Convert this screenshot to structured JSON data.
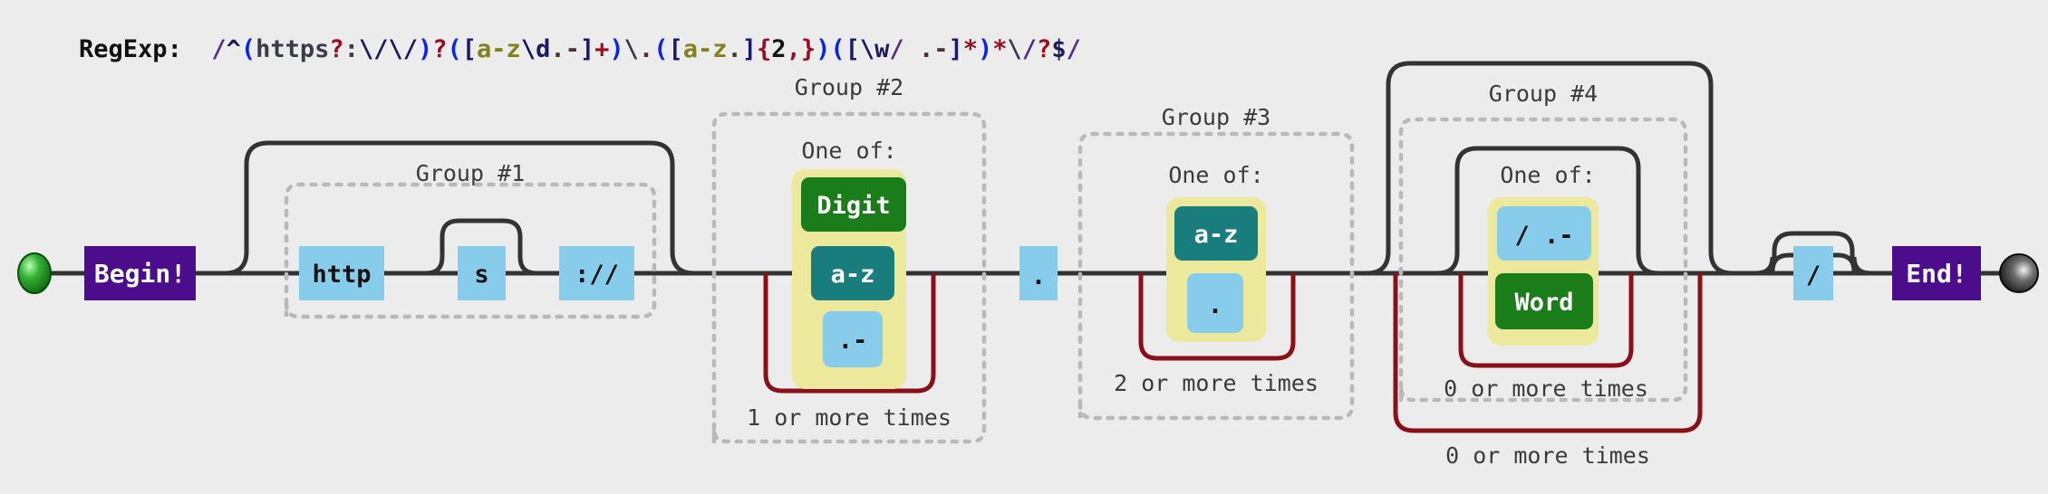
{
  "header": {
    "label": "RegExp:",
    "pattern": "/^(https?:\\/\\/)?([a-z\\d.-]+)\\.([a-z.]{2,})([\\w/ .-]*)*\\/?$/",
    "tokens": [
      {
        "t": "/",
        "c": "t-slash"
      },
      {
        "t": "^",
        "c": "t-anchor"
      },
      {
        "t": "(",
        "c": "t-paren"
      },
      {
        "t": "https",
        "c": "t-lit"
      },
      {
        "t": "?",
        "c": "t-quant"
      },
      {
        "t": ":",
        "c": "t-lit"
      },
      {
        "t": "\\/",
        "c": "t-esc"
      },
      {
        "t": "\\/",
        "c": "t-esc"
      },
      {
        "t": ")",
        "c": "t-paren"
      },
      {
        "t": "?",
        "c": "t-quant"
      },
      {
        "t": "(",
        "c": "t-paren"
      },
      {
        "t": "[",
        "c": "t-bracket"
      },
      {
        "t": "a-z",
        "c": "t-class"
      },
      {
        "t": "\\d",
        "c": "t-esc"
      },
      {
        "t": ".-",
        "c": "t-dot"
      },
      {
        "t": "]",
        "c": "t-bracket"
      },
      {
        "t": "+",
        "c": "t-quant"
      },
      {
        "t": ")",
        "c": "t-paren"
      },
      {
        "t": "\\",
        "c": "t-lit"
      },
      {
        "t": ".",
        "c": "t-dot"
      },
      {
        "t": "(",
        "c": "t-paren"
      },
      {
        "t": "[",
        "c": "t-bracket"
      },
      {
        "t": "a-z",
        "c": "t-class"
      },
      {
        "t": ".",
        "c": "t-dot"
      },
      {
        "t": "]",
        "c": "t-bracket"
      },
      {
        "t": "{",
        "c": "t-brace"
      },
      {
        "t": "2",
        "c": "t-num"
      },
      {
        "t": ",",
        "c": "t-comma"
      },
      {
        "t": "}",
        "c": "t-brace"
      },
      {
        "t": ")",
        "c": "t-paren"
      },
      {
        "t": "(",
        "c": "t-paren"
      },
      {
        "t": "[",
        "c": "t-bracket"
      },
      {
        "t": "\\w",
        "c": "t-esc"
      },
      {
        "t": "/",
        "c": "t-slash"
      },
      {
        "t": " ",
        "c": "t-lit"
      },
      {
        "t": ".-",
        "c": "t-dot"
      },
      {
        "t": "]",
        "c": "t-bracket"
      },
      {
        "t": "*",
        "c": "t-quant"
      },
      {
        "t": ")",
        "c": "t-paren"
      },
      {
        "t": "*",
        "c": "t-quant"
      },
      {
        "t": "\\",
        "c": "t-lit"
      },
      {
        "t": "/",
        "c": "t-slash"
      },
      {
        "t": "?",
        "c": "t-quant"
      },
      {
        "t": "$",
        "c": "t-anchor"
      },
      {
        "t": "/",
        "c": "t-slash"
      }
    ]
  },
  "colors": {
    "background": "#ececec",
    "wire": "#333333",
    "anchor_purple": "#4b0d8c",
    "literal_blue": "#87cdeb",
    "class_teal": "#1a7d7d",
    "escape_green": "#1a7d1a",
    "oneof_yellow": "#ece89c",
    "loop_red": "#8b0f18",
    "group_dotted": "#b9b9b9",
    "start_node_green": "#2e9e2e",
    "end_node_grey": "#3a3a3a"
  },
  "diagram": {
    "start_node": "start-circle",
    "end_node": "end-circle",
    "begin_label": "Begin!",
    "end_label": "End!",
    "group1": {
      "title": "Group #1",
      "items": [
        "http",
        "s",
        "://"
      ],
      "optional_item": "s"
    },
    "group2": {
      "title": "Group #2",
      "one_of_label": "One of:",
      "options": [
        {
          "label": "Digit",
          "kind": "escape"
        },
        {
          "label": "a-z",
          "kind": "class"
        },
        {
          "label": ".-",
          "kind": "literal"
        }
      ],
      "quantifier": "1 or more times"
    },
    "dot_node": ".",
    "group3": {
      "title": "Group #3",
      "one_of_label": "One of:",
      "options": [
        {
          "label": "a-z",
          "kind": "class"
        },
        {
          "label": ".",
          "kind": "literal"
        }
      ],
      "quantifier": "2 or more times"
    },
    "group4": {
      "title": "Group #4",
      "one_of_label": "One of:",
      "options": [
        {
          "label": "/ .-",
          "kind": "literal"
        },
        {
          "label": "Word",
          "kind": "escape"
        }
      ],
      "inner_quantifier": "0 or more times",
      "outer_quantifier": "0 or more times"
    },
    "trailing_slash": "/"
  }
}
